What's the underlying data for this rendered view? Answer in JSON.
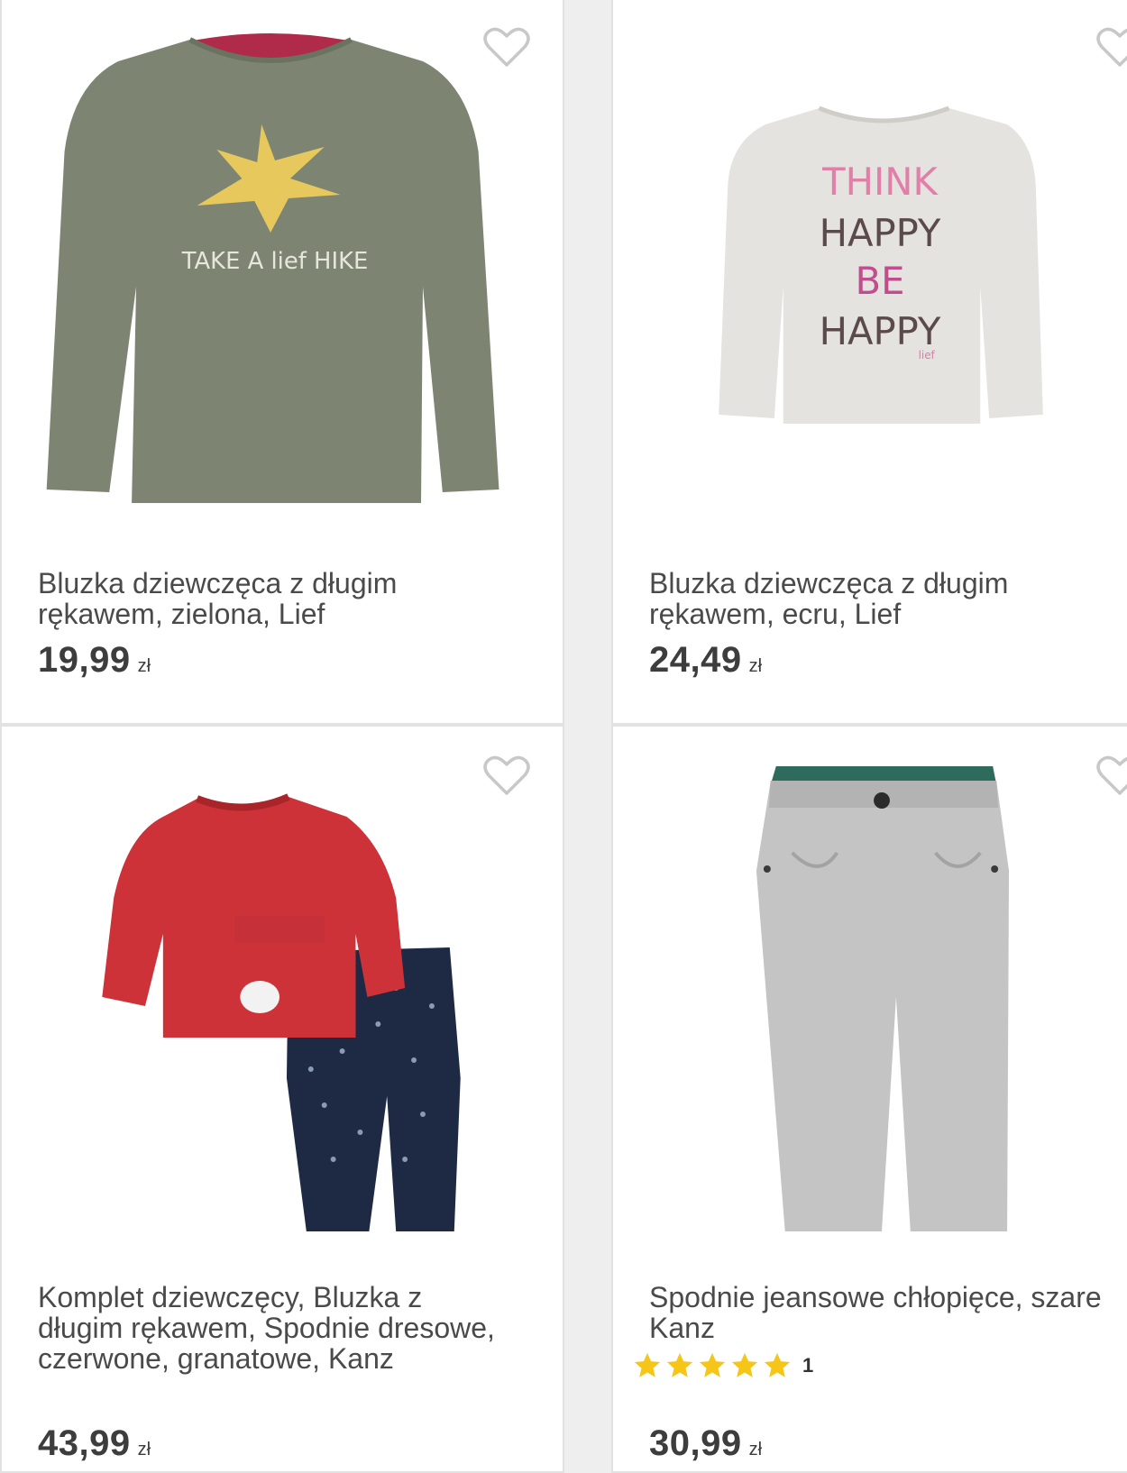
{
  "products": [
    {
      "title": "Bluzka dziewczęca z długim\nrękawem, zielona, Lief",
      "price": "19,99",
      "currency": "zł",
      "image_text": "TAKE A lief HIKE",
      "favorite_icon": "heart-outline-icon"
    },
    {
      "title": "Bluzka dziewczęca z długim\nrękawem, ecru, Lief",
      "price": "24,49",
      "currency": "zł",
      "image_text": [
        "THINK",
        "HAPPY",
        "BE",
        "HAPPY",
        "lief"
      ],
      "favorite_icon": "heart-outline-icon"
    },
    {
      "title": "Komplet dziewczęcy, Bluzka z\ndługim rękawem, Spodnie dresowe,\nczerwone, granatowe, Kanz",
      "price": "43,99",
      "currency": "zł",
      "favorite_icon": "heart-outline-icon"
    },
    {
      "title": "Spodnie jeansowe chłopięce, szare\nKanz",
      "price": "30,99",
      "currency": "zł",
      "rating": {
        "stars": 5,
        "count": "1"
      },
      "favorite_icon": "heart-outline-icon"
    }
  ],
  "colors": {
    "star": "#f5c518",
    "text": "#4a4a4a",
    "heart": "#c8c8c8"
  }
}
